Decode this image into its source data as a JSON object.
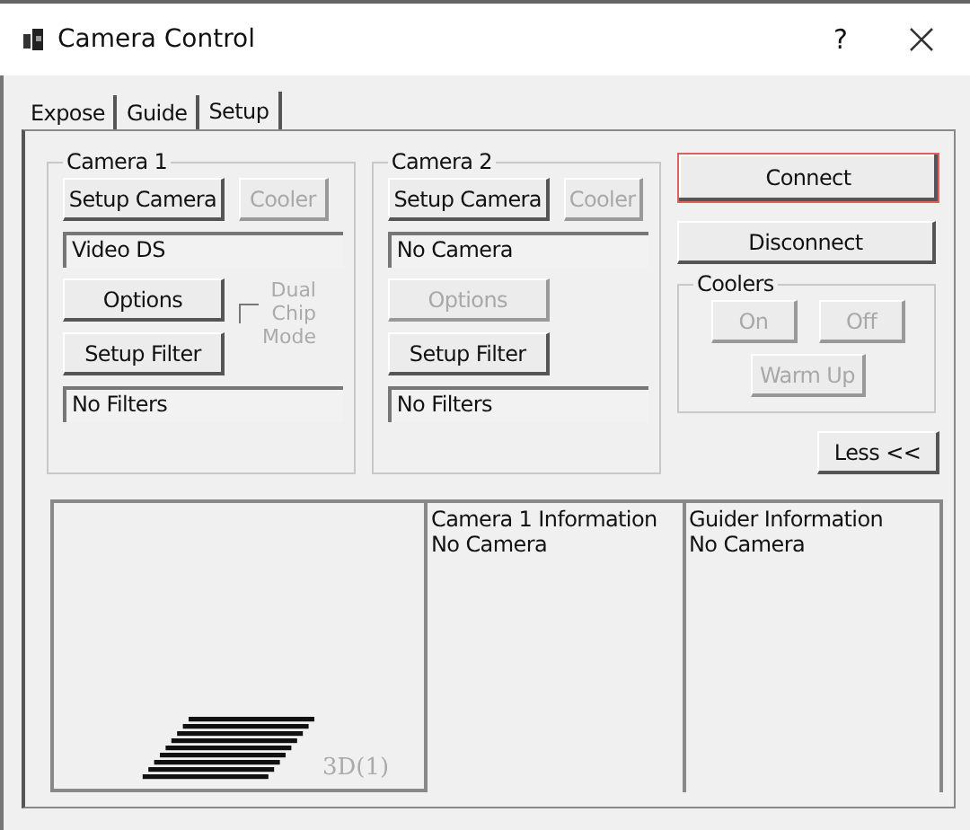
{
  "window": {
    "title": "Camera Control",
    "help": "?"
  },
  "tabs": [
    {
      "label": "Expose",
      "selected": false
    },
    {
      "label": "Guide",
      "selected": false
    },
    {
      "label": "Setup",
      "selected": true
    }
  ],
  "cameras": [
    {
      "title": "Camera 1",
      "setup_camera": "Setup Camera",
      "cooler": {
        "label": "Cooler",
        "disabled": true
      },
      "device": "Video DS",
      "options": {
        "label": "Options",
        "disabled": false
      },
      "dual_chip": {
        "label": "Dual Chip Mode",
        "checked": false,
        "disabled": true
      },
      "setup_filter": "Setup Filter",
      "filters": "No Filters"
    },
    {
      "title": "Camera 2",
      "setup_camera": "Setup Camera",
      "cooler": {
        "label": "Cooler",
        "disabled": true
      },
      "device": "No Camera",
      "options": {
        "label": "Options",
        "disabled": true
      },
      "setup_filter": "Setup Filter",
      "filters": "No Filters"
    }
  ],
  "connect": {
    "label": "Connect",
    "highlighted": true
  },
  "disconnect": {
    "label": "Disconnect"
  },
  "coolers": {
    "title": "Coolers",
    "buttons": [
      {
        "label": "On",
        "disabled": true
      },
      {
        "label": "Off",
        "disabled": true
      },
      {
        "label": "Warm Up",
        "disabled": true
      }
    ]
  },
  "less_button": "Less <<",
  "preview": {
    "label": "3D(1)"
  },
  "info_panels": [
    {
      "title": "Camera 1 Information",
      "value": "No Camera"
    },
    {
      "title": "Guider Information",
      "value": "No Camera"
    }
  ]
}
